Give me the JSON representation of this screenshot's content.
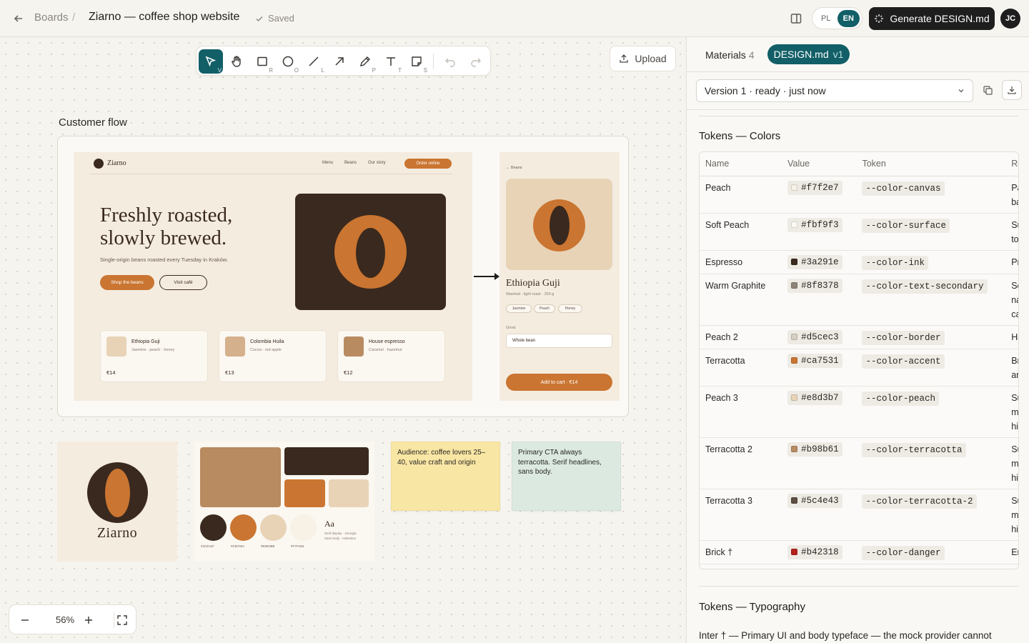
{
  "header": {
    "breadcrumb": "Boards",
    "separator": "/",
    "title": "Ziarno — coffee shop website",
    "status": "Saved",
    "lang_pl": "PL",
    "lang_en": "EN",
    "generate_label": "Generate DESIGN.md",
    "avatar": "JC"
  },
  "toolbar": {
    "tools": [
      {
        "name": "select",
        "key": "V"
      },
      {
        "name": "hand",
        "key": ""
      },
      {
        "name": "rectangle",
        "key": "R"
      },
      {
        "name": "ellipse",
        "key": "O"
      },
      {
        "name": "line",
        "key": "L"
      },
      {
        "name": "arrow",
        "key": ""
      },
      {
        "name": "pen",
        "key": "P"
      },
      {
        "name": "text",
        "key": "T"
      },
      {
        "name": "sticky",
        "key": "S"
      }
    ],
    "upload_label": "Upload"
  },
  "canvas": {
    "flow_label": "Customer flow",
    "home": {
      "logo": "Ziarno",
      "nav": [
        "Menu",
        "Beans",
        "Our story"
      ],
      "order_btn": "Order online",
      "headline": "Freshly roasted, slowly brewed.",
      "sub": "Single-origin beans roasted every Tuesday in Kraków.",
      "btn_primary": "Shop the beans",
      "btn_secondary": "Visit café",
      "cards": [
        {
          "name": "Ethiopia Guji",
          "notes": "Jasmine · peach · honey",
          "price": "€14",
          "color": "#e8d3b7"
        },
        {
          "name": "Colombia Huila",
          "notes": "Cocoa · red apple",
          "price": "€13",
          "color": "#d5b08c"
        },
        {
          "name": "House espresso",
          "notes": "Caramel · hazelnut",
          "price": "€12",
          "color": "#b98b61"
        }
      ]
    },
    "product": {
      "back": "← Beans",
      "name": "Ethiopia Guji",
      "meta": "Washed · light roast · 250 g",
      "chips": [
        "Jasmine",
        "Peach",
        "Honey"
      ],
      "grind_label": "Grind",
      "grind_value": "Whole bean",
      "cart": "Add to cart · €14"
    },
    "logo_card": {
      "name": "Ziarno"
    },
    "palette_card": {
      "hexes": [
        "#3A2A1F",
        "#CB702A",
        "#E8D3B8",
        "#F7F1E6"
      ],
      "aa": "Aa",
      "type_line1": "Serif display · Georgia",
      "type_line2": "Sans body · Helvetica"
    },
    "sticky_yellow": "Audience: coffee lovers 25–40, value craft and origin",
    "sticky_green": "Primary CTA always terracotta. Serif headlines, sans body.",
    "zoom": "56%"
  },
  "panel": {
    "tab_materials": "Materials",
    "materials_count": "4",
    "tab_design": "DESIGN.md",
    "tab_design_version": "v1",
    "version_select": "Version 1 · ready · just now",
    "colors_title": "Tokens — Colors",
    "columns": [
      "Name",
      "Value",
      "Token",
      "Role"
    ],
    "rows": [
      {
        "name": "Peach",
        "value": "#f7f2e7",
        "token": "--color-canvas",
        "role": "Page canvas background"
      },
      {
        "name": "Soft Peach",
        "value": "#fbf9f3",
        "token": "--color-surface",
        "role": "Surface for tonal step a"
      },
      {
        "name": "Espresso",
        "value": "#3a291e",
        "token": "--color-ink",
        "role": "Primary text"
      },
      {
        "name": "Warm Graphite",
        "value": "#8f8378",
        "token": "--color-text-secondary",
        "role": "Secondary navigation canvas)"
      },
      {
        "name": "Peach 2",
        "value": "#d5cec3",
        "token": "--color-border",
        "role": "Hairline bo"
      },
      {
        "name": "Terracotta",
        "value": "#ca7531",
        "token": "--color-accent",
        "role": "Brand acce and key hig"
      },
      {
        "name": "Peach 3",
        "value": "#e8d3b7",
        "token": "--color-peach",
        "role": "Supporting materials – highlights"
      },
      {
        "name": "Terracotta 2",
        "value": "#b98b61",
        "token": "--color-terracotta",
        "role": "Supporting materials – highlights"
      },
      {
        "name": "Terracotta 3",
        "value": "#5c4e43",
        "token": "--color-terracotta-2",
        "role": "Supporting materials – highlights"
      },
      {
        "name": "Brick †",
        "value": "#b42318",
        "token": "--color-danger",
        "role": "Errors and"
      }
    ],
    "typo_title": "Tokens — Typography",
    "typo_line": "Inter † — Primary UI and body typeface — the mock provider cannot"
  }
}
